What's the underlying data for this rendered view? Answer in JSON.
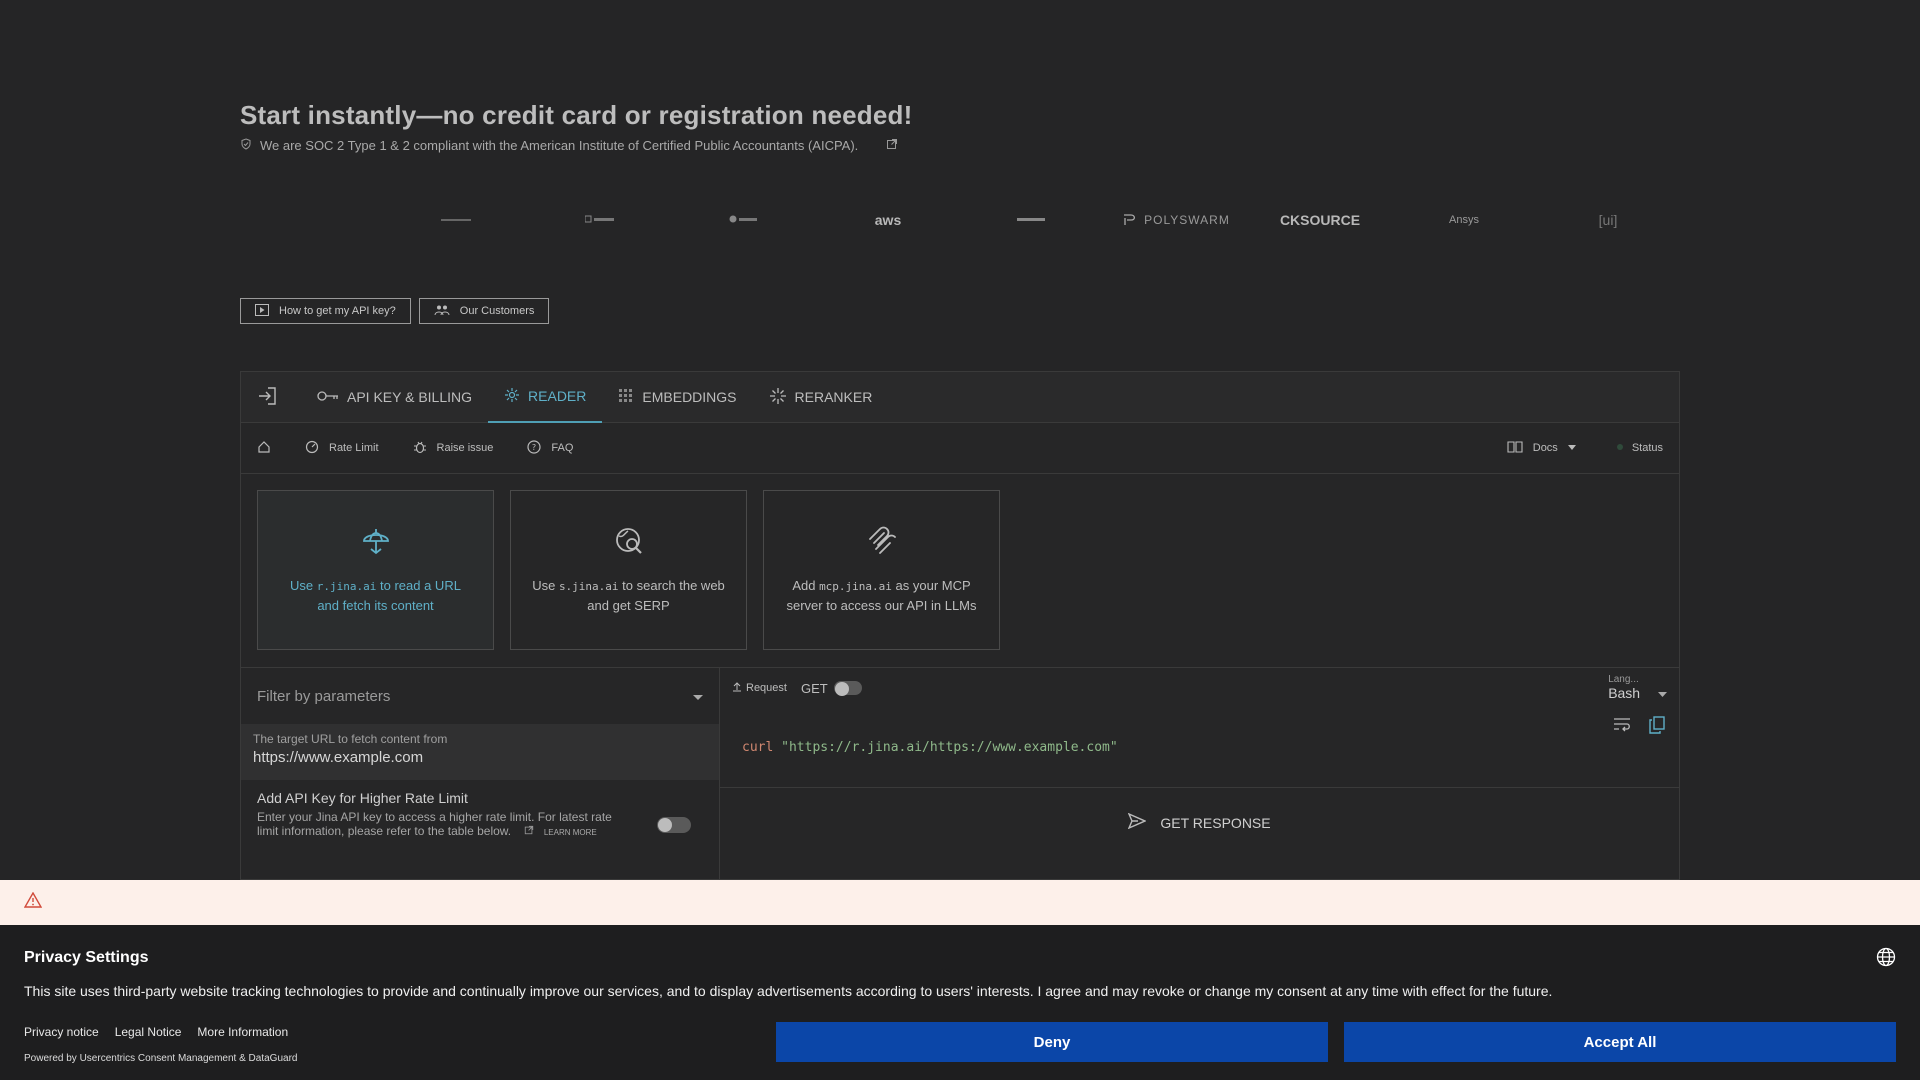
{
  "hero": {
    "title": "Start instantly—no credit card or registration needed!",
    "soc_text": "We are SOC 2 Type 1 & 2 compliant with the American Institute of Certified Public Accountants (AICPA)."
  },
  "logos": [
    "",
    "",
    "",
    "",
    "aws",
    "",
    "POLYSWARM",
    "CKSOURCE",
    "Ansys",
    "[ui]"
  ],
  "buttons": {
    "api_key_help": "How to get my API key?",
    "customers": "Our Customers"
  },
  "tabs": [
    {
      "label": "API KEY & BILLING",
      "icon": "key-icon"
    },
    {
      "label": "READER",
      "icon": "reader-icon"
    },
    {
      "label": "EMBEDDINGS",
      "icon": "grid-icon"
    },
    {
      "label": "RERANKER",
      "icon": "sparkle-icon"
    }
  ],
  "subnav": {
    "rate_limit": "Rate Limit",
    "raise_issue": "Raise issue",
    "faq": "FAQ",
    "docs": "Docs",
    "status": "Status"
  },
  "cards": [
    {
      "pre": "Use ",
      "code": "r.jina.ai",
      "post": " to read a URL and fetch its content"
    },
    {
      "pre": "Use ",
      "code": "s.jina.ai",
      "post": " to search the web and get SERP"
    },
    {
      "pre": "Add ",
      "code": "mcp.jina.ai",
      "post": " as your MCP server to access our API in LLMs"
    }
  ],
  "params": {
    "filter_placeholder": "Filter by parameters",
    "url_label": "The target URL to fetch content from",
    "url_value": "https://www.example.com",
    "apikey_title": "Add API Key for Higher Rate Limit",
    "apikey_desc": "Enter your Jina API key to access a higher rate limit. For latest rate limit information, please refer to the table below.",
    "learn_more": "LEARN MORE"
  },
  "request": {
    "label": "Request",
    "method": "GET",
    "lang_short": "Lang...",
    "lang_value": "Bash",
    "code_cmd": "curl",
    "code_url": "\"https://r.jina.ai/https://www.example.com\"",
    "get_response": "GET RESPONSE"
  },
  "privacy": {
    "title": "Privacy Settings",
    "text": "This site uses third-party website tracking technologies to provide and continually improve our services, and to display advertisements according to users' interests. I agree and may revoke or change my consent at any time with effect for the future.",
    "privacy_notice": "Privacy notice",
    "legal_notice": "Legal Notice",
    "more_info": "More Information",
    "powered": "Powered by Usercentrics Consent Management & DataGuard",
    "deny": "Deny",
    "accept": "Accept All"
  },
  "colors": {
    "accent": "#5fb0c8",
    "button_blue": "#0b46a8",
    "warning_bg": "#fdf0ea"
  }
}
